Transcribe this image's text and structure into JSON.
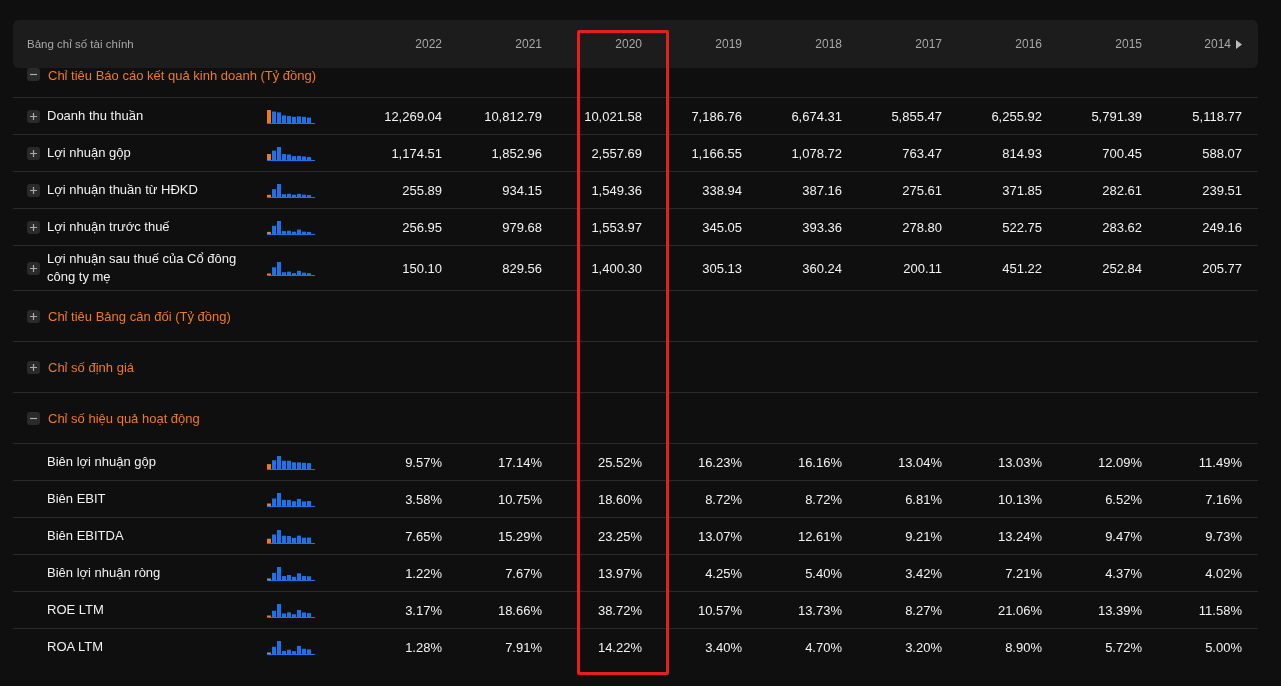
{
  "table": {
    "title": "Bảng chỉ số tài chính",
    "columns": [
      {
        "label": "2022",
        "highlighted": false
      },
      {
        "label": "2021",
        "highlighted": false
      },
      {
        "label": "2020",
        "highlighted": true
      },
      {
        "label": "2019",
        "highlighted": false
      },
      {
        "label": "2018",
        "highlighted": false
      },
      {
        "label": "2017",
        "highlighted": false
      },
      {
        "label": "2016",
        "highlighted": false
      },
      {
        "label": "2015",
        "highlighted": false
      },
      {
        "label": "2014",
        "highlighted": false
      }
    ],
    "sections": [
      {
        "title": "Chỉ tiêu Báo cáo kết quả kinh doanh (Tỷ đồng)",
        "expanded": true,
        "rows": [
          {
            "label": "Doanh thu thuần",
            "expandable": true,
            "values": [
              "12,269.04",
              "10,812.79",
              "10,021.58",
              "7,186.76",
              "6,674.31",
              "5,855.47",
              "6,255.92",
              "5,791.39",
              "5,118.77"
            ]
          },
          {
            "label": "Lợi nhuận gộp",
            "expandable": true,
            "values": [
              "1,174.51",
              "1,852.96",
              "2,557.69",
              "1,166.55",
              "1,078.72",
              "763.47",
              "814.93",
              "700.45",
              "588.07"
            ]
          },
          {
            "label": "Lợi nhuận thuần từ HĐKD",
            "expandable": true,
            "values": [
              "255.89",
              "934.15",
              "1,549.36",
              "338.94",
              "387.16",
              "275.61",
              "371.85",
              "282.61",
              "239.51"
            ]
          },
          {
            "label": "Lợi nhuận trước thuế",
            "expandable": true,
            "values": [
              "256.95",
              "979.68",
              "1,553.97",
              "345.05",
              "393.36",
              "278.80",
              "522.75",
              "283.62",
              "249.16"
            ]
          },
          {
            "label": "Lợi nhuận sau thuế của Cổ đông công ty mẹ",
            "expandable": true,
            "values": [
              "150.10",
              "829.56",
              "1,400.30",
              "305.13",
              "360.24",
              "200.11",
              "451.22",
              "252.84",
              "205.77"
            ]
          }
        ]
      },
      {
        "title": "Chỉ tiêu Bảng cân đối (Tỷ đồng)",
        "expanded": false
      },
      {
        "title": "Chỉ số định giá",
        "expanded": false
      },
      {
        "title": "Chỉ số hiệu quả hoạt động",
        "expanded": true,
        "rows": [
          {
            "label": "Biên lợi nhuận gộp",
            "expandable": false,
            "values": [
              "9.57%",
              "17.14%",
              "25.52%",
              "16.23%",
              "16.16%",
              "13.04%",
              "13.03%",
              "12.09%",
              "11.49%"
            ]
          },
          {
            "label": "Biên EBIT",
            "expandable": false,
            "values": [
              "3.58%",
              "10.75%",
              "18.60%",
              "8.72%",
              "8.72%",
              "6.81%",
              "10.13%",
              "6.52%",
              "7.16%"
            ]
          },
          {
            "label": "Biên EBITDA",
            "expandable": false,
            "values": [
              "7.65%",
              "15.29%",
              "23.25%",
              "13.07%",
              "12.61%",
              "9.21%",
              "13.24%",
              "9.47%",
              "9.73%"
            ]
          },
          {
            "label": "Biên lợi nhuận ròng",
            "expandable": false,
            "values": [
              "1.22%",
              "7.67%",
              "13.97%",
              "4.25%",
              "5.40%",
              "3.42%",
              "7.21%",
              "4.37%",
              "4.02%"
            ]
          },
          {
            "label": "ROE LTM",
            "expandable": false,
            "values": [
              "3.17%",
              "18.66%",
              "38.72%",
              "10.57%",
              "13.73%",
              "8.27%",
              "21.06%",
              "13.39%",
              "11.58%"
            ]
          },
          {
            "label": "ROA LTM",
            "expandable": false,
            "values": [
              "1.28%",
              "7.91%",
              "14.22%",
              "3.40%",
              "4.70%",
              "3.20%",
              "8.90%",
              "5.72%",
              "5.00%"
            ]
          }
        ]
      }
    ]
  }
}
